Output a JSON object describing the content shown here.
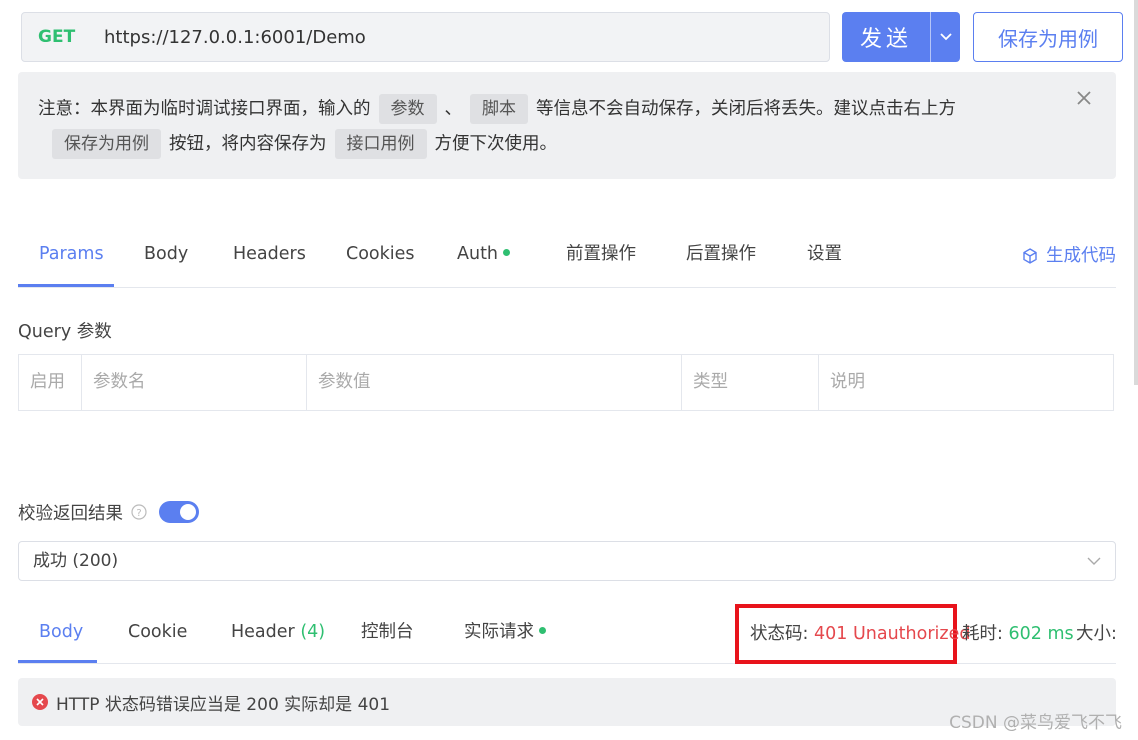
{
  "request": {
    "method": "GET",
    "url": "https://127.0.0.1:6001/Demo",
    "send_label": "发送",
    "save_case_label": "保存为用例"
  },
  "notice": {
    "prefix": "注意：本界面为临时调试接口界面，输入的",
    "chip_params": "参数",
    "sep": "、",
    "chip_script": "脚本",
    "middle": "等信息不会自动保存，关闭后将丢失。建议点击右上方",
    "chip_save": "保存为用例",
    "middle2": "按钮，将内容保存为",
    "chip_case": "接口用例",
    "suffix": "方便下次使用。"
  },
  "tabs": [
    {
      "label": "Params",
      "active": true
    },
    {
      "label": "Body"
    },
    {
      "label": "Headers"
    },
    {
      "label": "Cookies"
    },
    {
      "label": "Auth",
      "dot": true
    },
    {
      "label": "前置操作"
    },
    {
      "label": "后置操作"
    },
    {
      "label": "设置"
    }
  ],
  "gen_code_label": "生成代码",
  "query": {
    "title": "Query 参数",
    "headers": [
      "启用",
      "参数名",
      "参数值",
      "类型",
      "说明"
    ]
  },
  "validate": {
    "label": "校验返回结果",
    "selected": "成功 (200)"
  },
  "response_tabs": {
    "body": "Body",
    "cookie": "Cookie",
    "header": "Header",
    "header_count": "(4)",
    "console": "控制台",
    "actual": "实际请求"
  },
  "response_status": {
    "status_label": "状态码:",
    "status_value": "401 Unauthorized",
    "time_label": "耗时:",
    "time_value": "602 ms",
    "size_label": "大小:"
  },
  "error_message": "HTTP 状态码错误应当是 200 实际却是 401",
  "watermark": "CSDN @菜鸟爱飞不飞",
  "colors": {
    "accent": "#5b7ff0",
    "success": "#2fbf71",
    "error": "#e5484d",
    "highlight_box": "#e8131b"
  }
}
